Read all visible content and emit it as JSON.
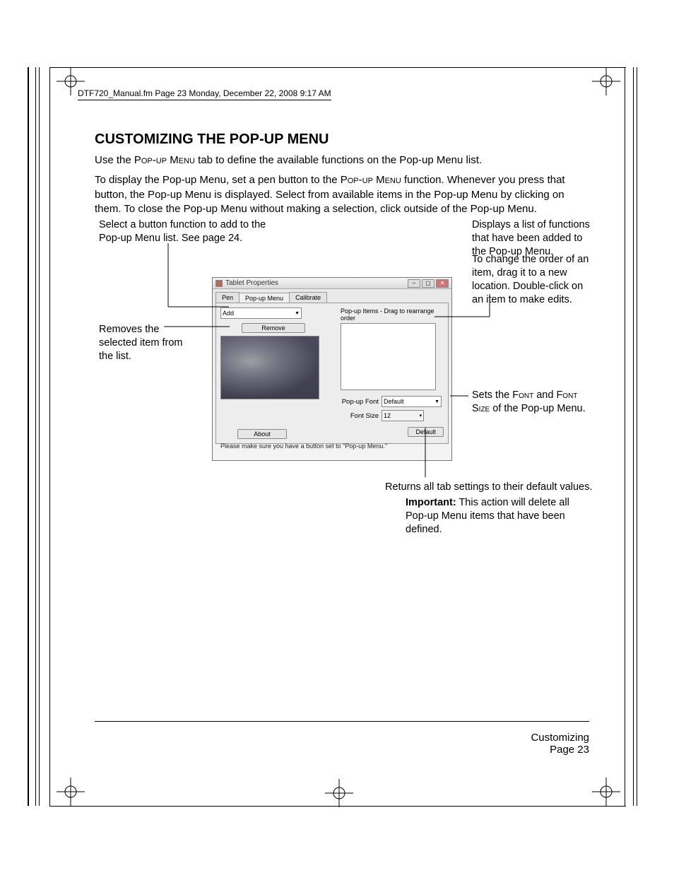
{
  "header": {
    "runhead": "DTF720_Manual.fm  Page 23  Monday, December 22, 2008  9:17 AM"
  },
  "page": {
    "heading": "CUSTOMIZING THE POP-UP MENU",
    "p1a": "Use the ",
    "p1b": "Pop-up Menu",
    "p1c": " tab to define the available functions on the Pop-up Menu list.",
    "p2a": "To display the Pop-up Menu, set a pen button to the ",
    "p2b": "Pop-up Menu",
    "p2c": " function.  Whenever you press that button, the Pop-up Menu is displayed.  Select from available items in the Pop-up Menu by clicking on them.  To close the Pop-up Menu without making a selection, click outside of the Pop-up Menu."
  },
  "callouts": {
    "addFn": "Select a button function to add to the Pop-up Menu list.  See page 24.",
    "remove": "Removes the selected item from the list.",
    "list": "Displays a list of functions that have been added to the Pop-up Menu.",
    "reorder": "To change the order of an item, drag it to a new location.  Double-click on an item to make edits.",
    "font_a": "Sets the ",
    "font_b": "Font",
    "font_c": " and ",
    "font_d": "Font Size",
    "font_e": " of the Pop-up Menu.",
    "defaultReturns": "Returns all tab settings to their default values.",
    "importantLabel": "Important:",
    "importantText": " This action will delete all Pop-up Menu items that have been defined."
  },
  "dialog": {
    "title": "Tablet Properties",
    "tabs": [
      "Pen",
      "Pop-up Menu",
      "Calibrate"
    ],
    "add": {
      "label": "Add"
    },
    "removeBtn": "Remove",
    "itemsLabel": "Pop-up Items - Drag to rearrange order",
    "fontLabel": "Pop-up Font",
    "fontValue": "Default",
    "sizeLabel": "Font Size",
    "sizeValue": "12",
    "defaultBtn": "Default",
    "hint": "Please make sure you have a button set to \"Pop-up Menu.\"",
    "aboutBtn": "About"
  },
  "footer": {
    "section": "Customizing",
    "pageLabel": "Page  23"
  }
}
